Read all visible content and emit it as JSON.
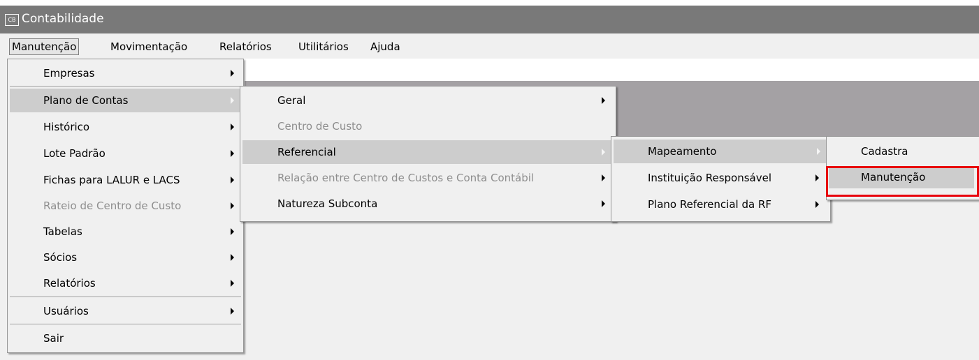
{
  "window": {
    "title": "Contabilidade",
    "icon_text": "CB"
  },
  "menubar": [
    "Manutenção",
    "Movimentação",
    "Relatórios",
    "Utilitários",
    "Ajuda"
  ],
  "menu1": [
    {
      "label": "Empresas"
    },
    {
      "label": "Plano de Contas"
    },
    {
      "label": "Histórico"
    },
    {
      "label": "Lote Padrão"
    },
    {
      "label": "Fichas para LALUR e LACS"
    },
    {
      "label": "Rateio de Centro de Custo"
    },
    {
      "label": "Tabelas"
    },
    {
      "label": "Sócios"
    },
    {
      "label": "Relatórios"
    },
    {
      "label": "Usuários"
    },
    {
      "label": "Sair"
    }
  ],
  "menu2": [
    {
      "label": "Geral"
    },
    {
      "label": "Centro de Custo"
    },
    {
      "label": "Referencial"
    },
    {
      "label": "Relação entre Centro de Custos e Conta Contábil"
    },
    {
      "label": "Natureza Subconta"
    }
  ],
  "menu3": [
    {
      "label": "Mapeamento"
    },
    {
      "label": "Instituição Responsável"
    },
    {
      "label": "Plano Referencial da RF"
    }
  ],
  "menu4": [
    {
      "label": "Cadastra"
    },
    {
      "label": "Manutenção"
    }
  ],
  "colors": {
    "accent_highlight": "#e8000c",
    "title_bar": "#797979",
    "menu_bg": "#f0f0f0",
    "menu_highlight": "#cdcdcd"
  }
}
